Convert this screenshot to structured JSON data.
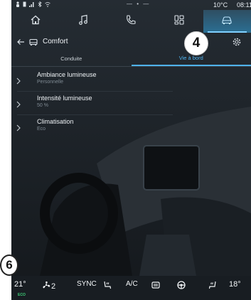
{
  "status_bar": {
    "center_dots": "— • —",
    "temperature": "10°C",
    "time": "08:11"
  },
  "nav": {
    "tabs": [
      {
        "icon": "home-icon"
      },
      {
        "icon": "music-note-icon"
      },
      {
        "icon": "phone-icon"
      },
      {
        "icon": "apps-icon"
      },
      {
        "icon": "car-icon",
        "active": true
      }
    ]
  },
  "header": {
    "title": "Comfort",
    "callout": "4"
  },
  "subtabs": [
    {
      "label": "Conduite",
      "active": false
    },
    {
      "label": "Vie à bord",
      "active": true
    }
  ],
  "settings": [
    {
      "label": "Ambiance lumineuse",
      "value": "Personnelle"
    },
    {
      "label": "Intensité lumineuse",
      "value": "50 %"
    },
    {
      "label": "Climatisation",
      "value": "Eco"
    }
  ],
  "climate": {
    "left_temp": "21°",
    "eco_label": "ECO",
    "fan_level": "2",
    "sync": "SYNC",
    "ac": "A/C",
    "right_temp": "18°"
  },
  "callout_bottom": "6",
  "colors": {
    "accent": "#4fb3f0",
    "active_tab": "#2b6f93",
    "eco": "#3ed27a"
  }
}
